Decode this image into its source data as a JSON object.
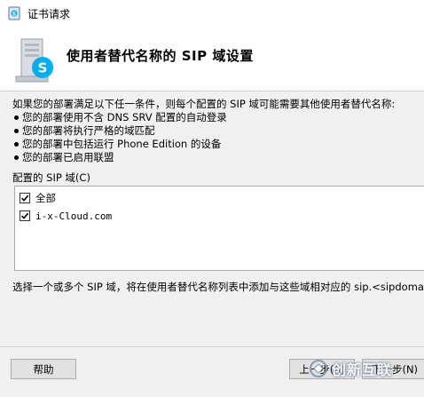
{
  "window": {
    "title": "证书请求"
  },
  "header": {
    "title": "使用者替代名称的 SIP 域设置"
  },
  "content": {
    "intro": "如果您的部署满足以下任一条件，则每个配置的 SIP 域可能需要其他使用者替代名称:",
    "conditions": [
      "您的部署使用不含 DNS SRV 配置的自动登录",
      "您的部署将执行严格的域匹配",
      "您的部署中包括运行 Phone Edition 的设备",
      "您的部署已启用联盟"
    ]
  },
  "domains": {
    "label": "配置的 SIP 域(C)",
    "items": [
      {
        "label": "全部",
        "checked": true
      },
      {
        "label": "i-x-Cloud.com",
        "checked": true
      }
    ]
  },
  "hint": "选择一个或多个 SIP 域，将在使用者替代名称列表中添加与这些域相对应的 sip.<sipdomain>",
  "buttons": {
    "help": "帮助",
    "back": "上一步(B)",
    "next": "下一步(N)"
  },
  "watermark": "创新互联",
  "colors": {
    "skype_blue": "#00aff0",
    "dialog_bg": "#f0f0f0"
  }
}
